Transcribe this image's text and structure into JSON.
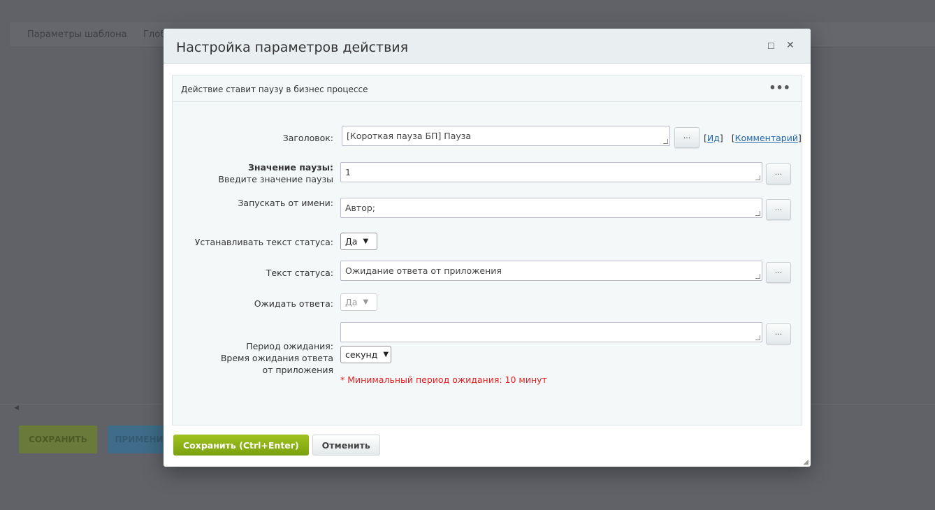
{
  "background": {
    "tabs": [
      "Параметры шаблона",
      "Глоб"
    ],
    "buttons": {
      "save": "СОХРАНИТЬ",
      "apply": "ПРИМЕНИ"
    }
  },
  "dialog": {
    "title": "Настройка параметров действия",
    "description": "Действие ставит паузу в бизнес процессе",
    "fields": {
      "title": {
        "label": "Заголовок:",
        "value": "[Короткая пауза БП] Пауза",
        "id_link": "Ид",
        "comment_link": "Комментарий"
      },
      "pause": {
        "label": "Значение паузы:",
        "hint": "Введите значение паузы",
        "value": "1"
      },
      "run_as": {
        "label": "Запускать от имени:",
        "value": "Автор;"
      },
      "set_status": {
        "label": "Устанавливать текст статуса:",
        "value": "Да"
      },
      "status_text": {
        "label": "Текст статуса:",
        "value": "Ожидание ответа от приложения"
      },
      "wait": {
        "label": "Ожидать ответа:",
        "value": "Да"
      },
      "period": {
        "label": "Период ожидания:",
        "hint": "Время ожидания ответа от приложения",
        "value": "",
        "unit": "секунд",
        "note": "* Минимальный период ожидания: 10 минут"
      }
    },
    "more_label": "...",
    "save": "Сохранить (Ctrl+Enter)",
    "cancel": "Отменить"
  },
  "colors": {
    "accent": "#8db415",
    "error": "#e02020",
    "link": "#2067b0"
  }
}
